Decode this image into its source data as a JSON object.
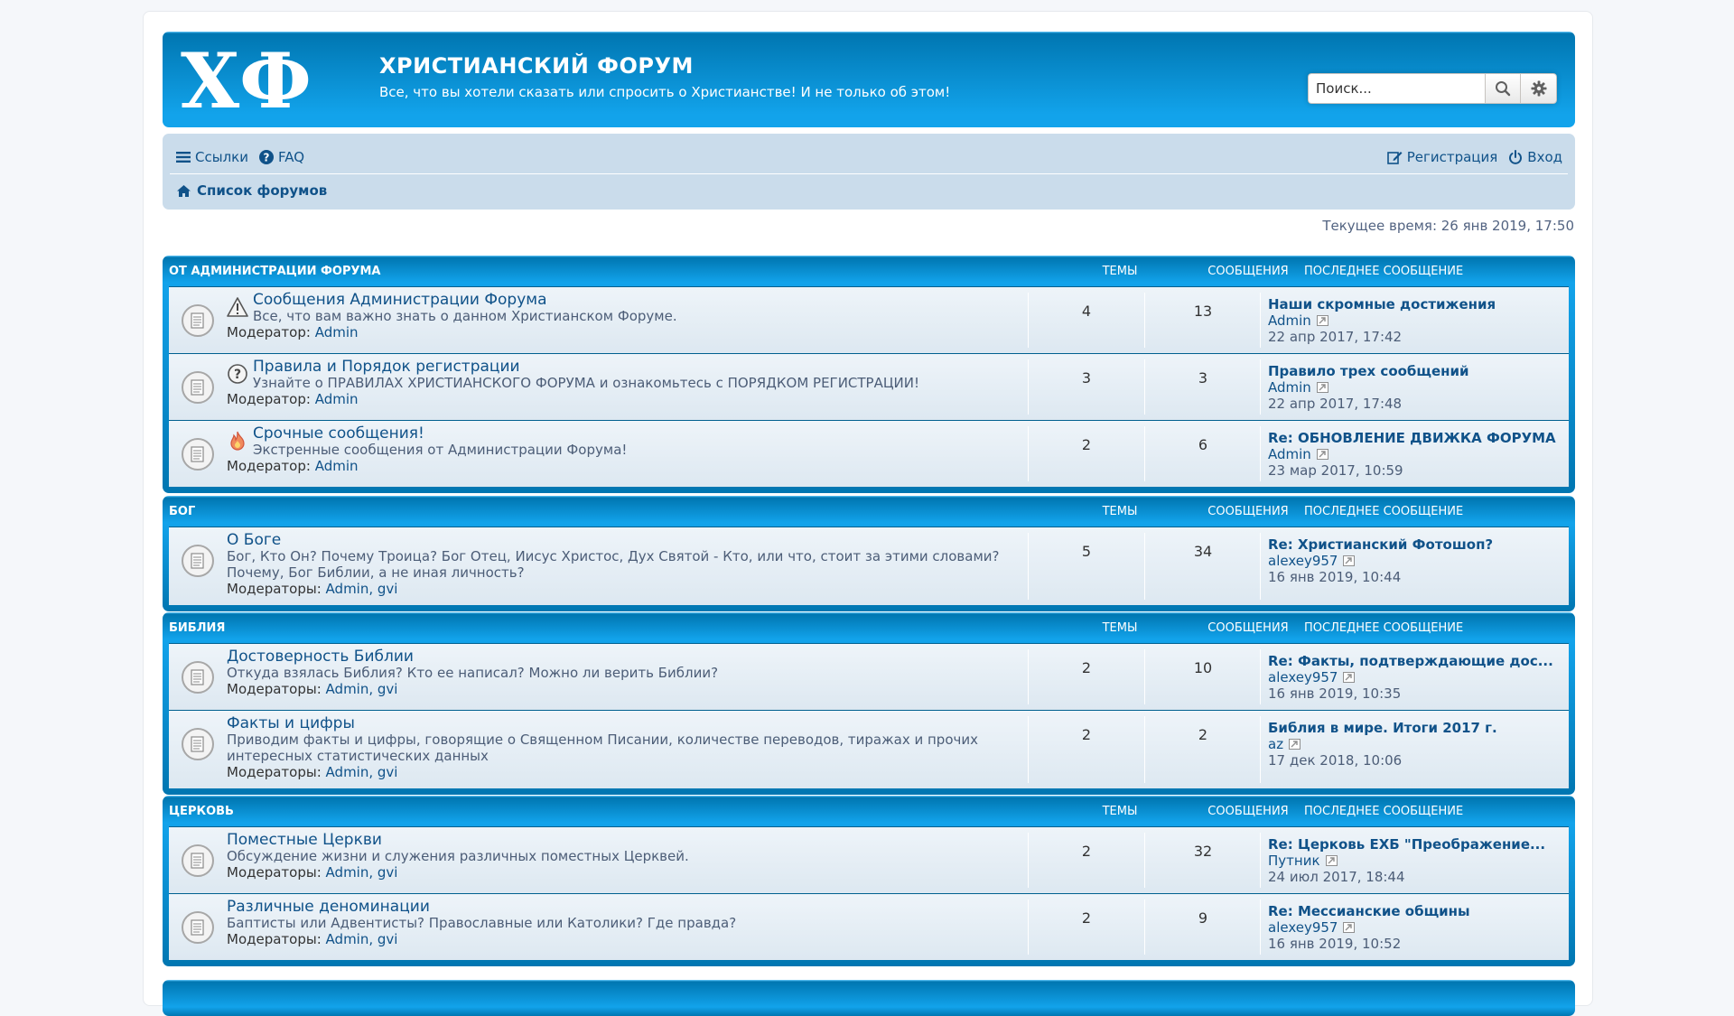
{
  "header": {
    "logo_text": "ХФ",
    "title": "ХРИСТИАНСКИЙ ФОРУМ",
    "description": "Все, что вы хотели сказать или спросить о Христианстве! И не только об этом!",
    "search_placeholder": "Поиск..."
  },
  "nav": {
    "links_label": "Ссылки",
    "faq_label": "FAQ",
    "register_label": "Регистрация",
    "login_label": "Вход",
    "breadcrumb": "Список форумов"
  },
  "current_time": "Текущее время: 26 янв 2019, 17:50",
  "columns": {
    "topics": "ТЕМЫ",
    "posts": "СООБЩЕНИЯ",
    "last": "ПОСЛЕДНЕЕ СООБЩЕНИЕ"
  },
  "categories": [
    {
      "name": "ОТ АДМИНИСТРАЦИИ ФОРУМА",
      "forums": [
        {
          "icon": "warning-icon",
          "title": "Сообщения Администрации Форума",
          "description": "Все, что вам важно знать о данном Христианском Форуме.",
          "mod_label": "Модератор:",
          "mods": "Admin",
          "topics": "4",
          "posts": "13",
          "last_title": "Наши скромные достижения",
          "last_author": "Admin",
          "last_date": "22 апр 2017, 17:42"
        },
        {
          "icon": "question-icon",
          "title": "Правила и Порядок регистрации",
          "description": "Узнайте о ПРАВИЛАХ ХРИСТИАНСКОГО ФОРУМА и ознакомьтесь с ПОРЯДКОМ РЕГИСТРАЦИИ!",
          "mod_label": "Модератор:",
          "mods": "Admin",
          "topics": "3",
          "posts": "3",
          "last_title": "Правило трех сообщений",
          "last_author": "Admin",
          "last_date": "22 апр 2017, 17:48"
        },
        {
          "icon": "fire-icon",
          "title": "Срочные сообщения!",
          "description": "Экстренные сообщения от Администрации Форума!",
          "mod_label": "Модератор:",
          "mods": "Admin",
          "topics": "2",
          "posts": "6",
          "last_title": "Re: ОБНОВЛЕНИЕ ДВИЖКА ФОРУМА",
          "last_author": "Admin",
          "last_date": "23 мар 2017, 10:59"
        }
      ]
    },
    {
      "name": "БОГ",
      "forums": [
        {
          "title": "О Боге",
          "description": "Бог, Кто Он? Почему Троица? Бог Отец, Иисус Христос, Дух Святой - Кто, или что, стоит за этими словами? Почему, Бог Библии, а не иная личность?",
          "mod_label": "Модераторы:",
          "mods": "Admin, gvi",
          "topics": "5",
          "posts": "34",
          "last_title": "Re: Христианский Фотошоп?",
          "last_author": "alexey957",
          "last_date": "16 янв 2019, 10:44"
        }
      ]
    },
    {
      "name": "БИБЛИЯ",
      "forums": [
        {
          "title": "Достоверность Библии",
          "description": "Откуда взялась Библия? Кто ее написал? Можно ли верить Библии?",
          "mod_label": "Модераторы:",
          "mods": "Admin, gvi",
          "topics": "2",
          "posts": "10",
          "last_title": "Re: Факты, подтверждающие дос...",
          "last_author": "alexey957",
          "last_date": "16 янв 2019, 10:35"
        },
        {
          "title": "Факты и цифры",
          "description": "Приводим факты и цифры, говорящие о Священном Писании, количестве переводов, тиражах и прочих интересных статистических данных",
          "mod_label": "Модераторы:",
          "mods": "Admin, gvi",
          "topics": "2",
          "posts": "2",
          "last_title": "Библия в мире. Итоги 2017 г.",
          "last_author": "az",
          "last_date": "17 дек 2018, 10:06"
        }
      ]
    },
    {
      "name": "ЦЕРКОВЬ",
      "forums": [
        {
          "title": "Поместные Церкви",
          "description": "Обсуждение жизни и служения различных поместных Церквей.",
          "mod_label": "Модераторы:",
          "mods": "Admin, gvi",
          "topics": "2",
          "posts": "32",
          "last_title": "Re: Церковь ЕХБ \"Преображение...",
          "last_author": "Путник",
          "last_date": "24 июл 2017, 18:44"
        },
        {
          "title": "Различные деноминации",
          "description": "Баптисты или Адвентисты? Православные или Католики? Где правда?",
          "mod_label": "Модераторы:",
          "mods": "Admin, gvi",
          "topics": "2",
          "posts": "9",
          "last_title": "Re: Мессианские общины",
          "last_author": "alexey957",
          "last_date": "16 янв 2019, 10:52"
        }
      ]
    }
  ]
}
